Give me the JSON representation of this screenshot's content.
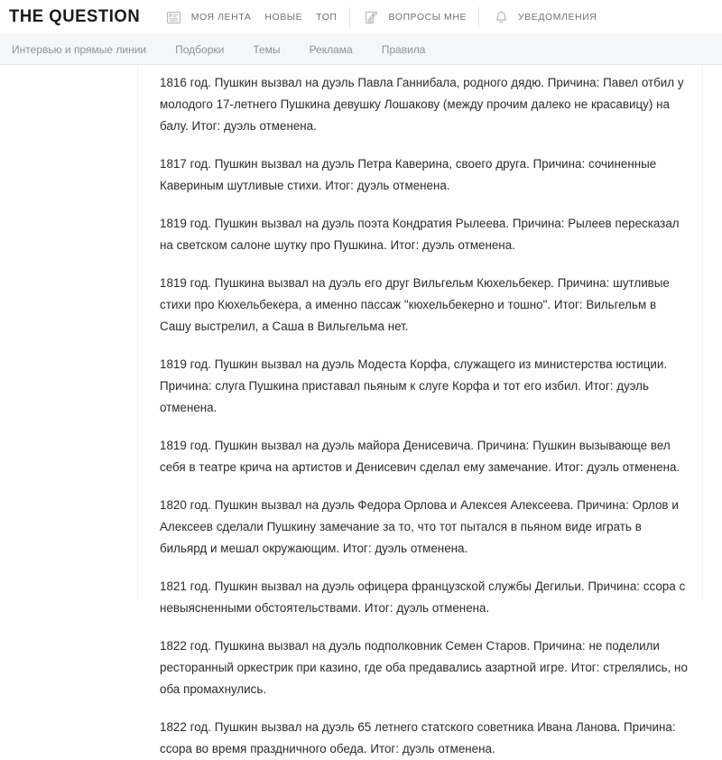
{
  "header": {
    "logo": "THE QUESTION",
    "nav": [
      {
        "icon": "feed-icon",
        "label": "МОЯ ЛЕНТА"
      },
      {
        "icon": null,
        "label": "НОВЫЕ"
      },
      {
        "icon": null,
        "label": "ТОП"
      },
      {
        "icon": "edit-icon",
        "label": "ВОПРОСЫ МНЕ"
      },
      {
        "icon": "bell-icon",
        "label": "УВЕДОМЛЕНИЯ"
      }
    ]
  },
  "subnav": {
    "items": [
      {
        "label": "Интервью и прямые линии"
      },
      {
        "label": "Подборки"
      },
      {
        "label": "Темы"
      },
      {
        "label": "Реклама"
      },
      {
        "label": "Правила"
      }
    ]
  },
  "article": {
    "paragraphs": [
      "1816 год. Пушкин вызвал на дуэль Павла Ганнибала, родного дядю. Причина: Павел отбил у молодого 17-летнего Пушкина девушку Лошакову (между прочим далеко не красавицу) на балу. Итог: дуэль отменена.",
      "1817 год. Пушкин вызвал на дуэль Петра Каверина, своего друга. Причина: сочиненные Кавериным шутливые стихи. Итог: дуэль отменена.",
      "1819 год. Пушкин вызвал на дуэль поэта Кондратия Рылеева. Причина: Рылеев пересказал на светском салоне шутку про Пушкина. Итог: дуэль отменена.",
      "1819 год. Пушкина вызвал на дуэль его друг Вильгельм Кюхельбекер. Причина: шутливые стихи про Кюхельбекера, а именно пассаж \"кюхельбекерно и тошно\". Итог: Вильгельм в Сашу выстрелил, а Саша в Вильгельма нет.",
      "1819 год. Пушкин вызвал на дуэль Модеста Корфа, служащего из министерства юстиции. Причина: слуга Пушкина приставал пьяным к слуге Корфа и тот его избил. Итог: дуэль отменена.",
      "1819 год. Пушкин вызвал на дуэль майора Денисевича. Причина: Пушкин вызывающе вел себя в театре крича на артистов и Денисевич сделал ему замечание. Итог: дуэль отменена.",
      "1820 год. Пушкин вызвал на дуэль Федора Орлова и Алексея Алексеева. Причина: Орлов и Алексеев сделали Пушкину замечание за то, что тот пытался в пьяном виде играть в бильярд и мешал окружающим. Итог: дуэль отменена.",
      "1821 год. Пушкин вызвал на дуэль офицера французской службы Дегильи. Причина: ссора с невыясненными обстоятельствами. Итог: дуэль отменена.",
      "1822 год. Пушкина вызвал на дуэль подполковник Семен Старов. Причина: не поделили ресторанный оркестрик при казино, где оба предавались азартной игре. Итог: стрелялись, но оба промахнулись.",
      "1822 год. Пушкин вызвал на дуэль 65 летнего статского советника Ивана Ланова. Причина: ссора во время праздничного обеда. Итог: дуэль отменена."
    ]
  },
  "colors": {
    "logo": "#1a1a1a",
    "nav_text": "#6d7278",
    "subnav_bg": "#f5f6f7",
    "subnav_text": "#8d9297",
    "body_text": "#2b2b2b",
    "icon": "#b9bdc1"
  }
}
